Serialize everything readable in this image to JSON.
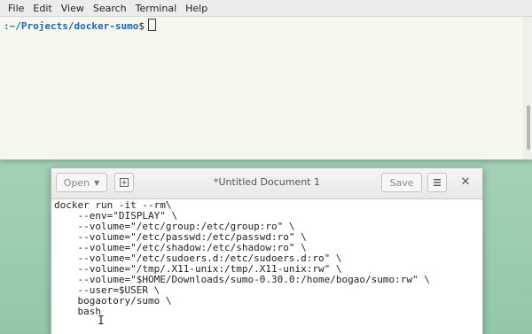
{
  "terminal": {
    "menu": [
      "File",
      "Edit",
      "View",
      "Search",
      "Terminal",
      "Help"
    ],
    "prompt_path": ":~/Projects/docker-sumo",
    "prompt_sign": "$"
  },
  "editor": {
    "open_label": "Open",
    "title": "*Untitled Document 1",
    "save_label": "Save",
    "lines": [
      "docker run -it --rm\\",
      "    --env=\"DISPLAY\" \\",
      "    --volume=\"/etc/group:/etc/group:ro\" \\",
      "    --volume=\"/etc/passwd:/etc/passwd:ro\" \\",
      "    --volume=\"/etc/shadow:/etc/shadow:ro\" \\",
      "    --volume=\"/etc/sudoers.d:/etc/sudoers.d:ro\" \\",
      "    --volume=\"/tmp/.X11-unix:/tmp/.X11-unix:rw\" \\",
      "    --volume=\"$HOME/Downloads/sumo-0.30.0:/home/bogao/sumo:rw\" \\",
      "    --user=$USER \\",
      "    bogaotory/sumo \\",
      "    bash"
    ]
  },
  "icons": {
    "open_caret": "chevron-down-icon",
    "new_doc": "new-document-icon",
    "menu": "hamburger-menu-icon",
    "close": "close-icon",
    "text_cursor": "i-beam-cursor-icon"
  },
  "colors": {
    "desktop": "#a5d2b8",
    "terminal_bg": "#f6f7ef",
    "prompt_path": "#1e64b4"
  }
}
